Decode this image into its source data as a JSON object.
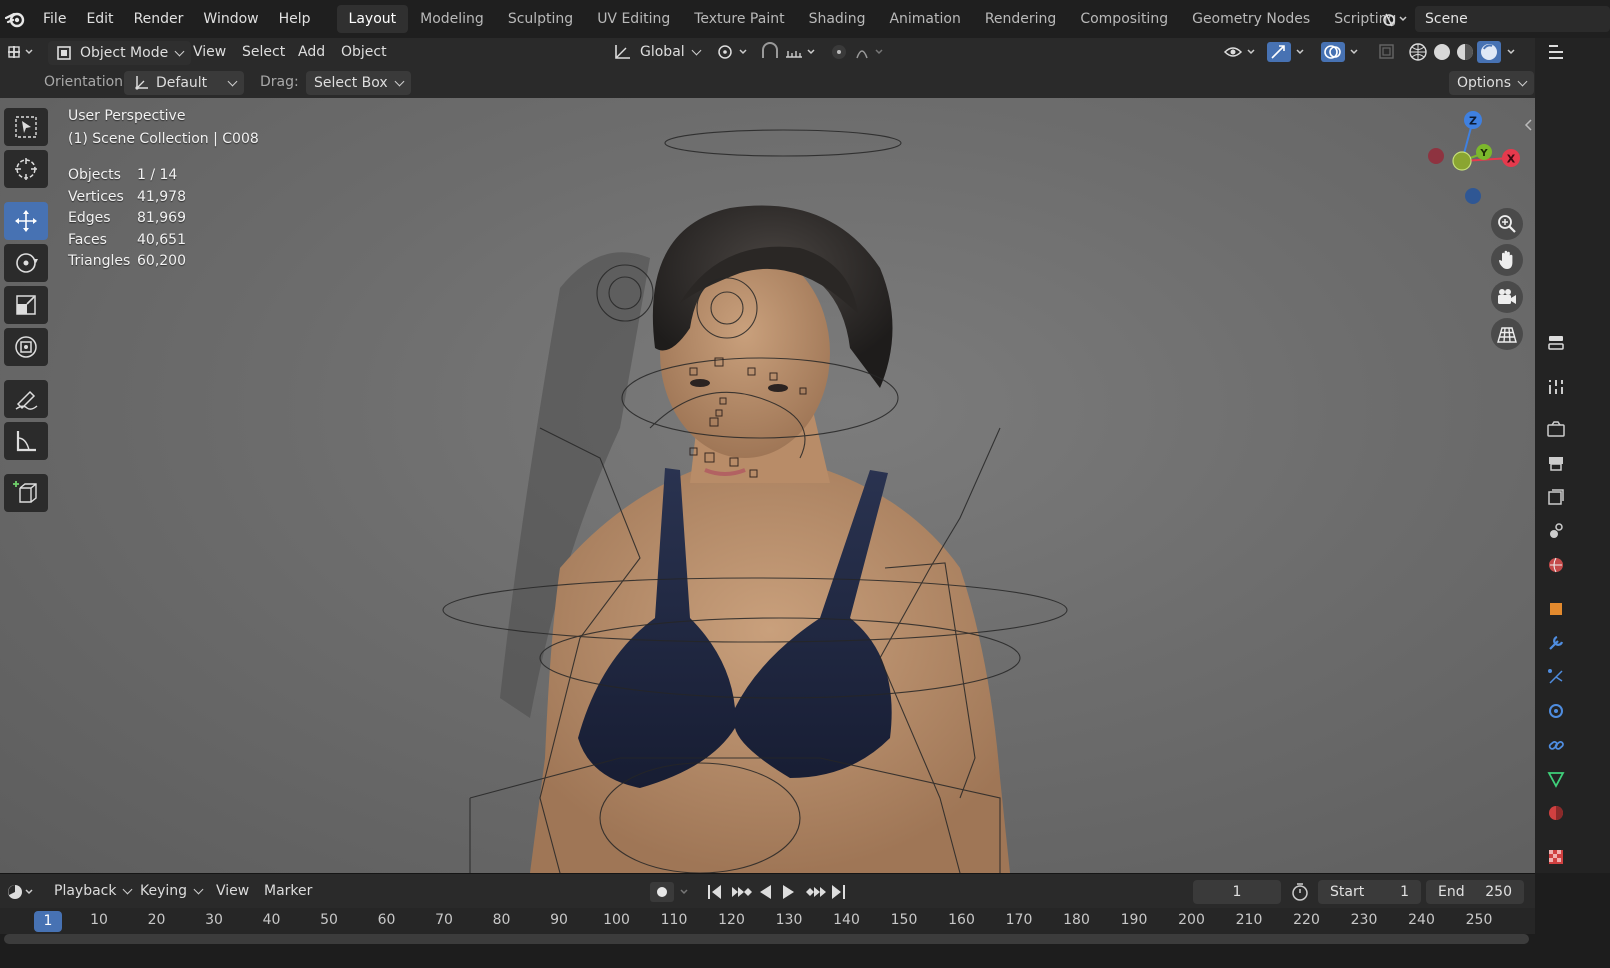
{
  "menu": {
    "items": [
      "File",
      "Edit",
      "Render",
      "Window",
      "Help"
    ]
  },
  "workspaces": {
    "tabs": [
      "Layout",
      "Modeling",
      "Sculpting",
      "UV Editing",
      "Texture Paint",
      "Shading",
      "Animation",
      "Rendering",
      "Compositing",
      "Geometry Nodes",
      "Scripting"
    ],
    "active": "Layout",
    "add_label": "+"
  },
  "scene": {
    "name": "Scene"
  },
  "header": {
    "mode": "Object Mode",
    "view": "View",
    "select": "Select",
    "add": "Add",
    "object": "Object",
    "transform_orientation": "Global"
  },
  "tool_settings": {
    "orientation_label": "Orientation:",
    "orientation_value": "Default",
    "drag_label": "Drag:",
    "drag_value": "Select Box",
    "options": "Options"
  },
  "viewport": {
    "perspective": "User Perspective",
    "collection": "(1) Scene Collection | C008",
    "stats": [
      {
        "label": "Objects",
        "value": "1 / 14"
      },
      {
        "label": "Vertices",
        "value": "41,978"
      },
      {
        "label": "Edges",
        "value": "81,969"
      },
      {
        "label": "Faces",
        "value": "40,651"
      },
      {
        "label": "Triangles",
        "value": "60,200"
      }
    ],
    "gizmo_axes": {
      "z": "Z",
      "y": "Y",
      "x": "X"
    },
    "colors": {
      "x": "#e53a4d",
      "y": "#7cb82c",
      "z": "#3f80e0",
      "active_tool": "#4772b3"
    }
  },
  "tools": [
    "select-box",
    "cursor",
    "move",
    "rotate",
    "scale",
    "transform",
    "annotate",
    "measure",
    "add-cube"
  ],
  "timeline": {
    "playback": "Playback",
    "keying": "Keying",
    "view": "View",
    "marker": "Marker",
    "current_frame": "1",
    "start_label": "Start",
    "start_value": "1",
    "end_label": "End",
    "end_value": "250",
    "ruler_current": "1",
    "ruler_ticks": [
      "10",
      "20",
      "30",
      "40",
      "50",
      "60",
      "70",
      "80",
      "90",
      "100",
      "110",
      "120",
      "130",
      "140",
      "150",
      "160",
      "170",
      "180",
      "190",
      "200",
      "210",
      "220",
      "230",
      "240",
      "250"
    ]
  }
}
